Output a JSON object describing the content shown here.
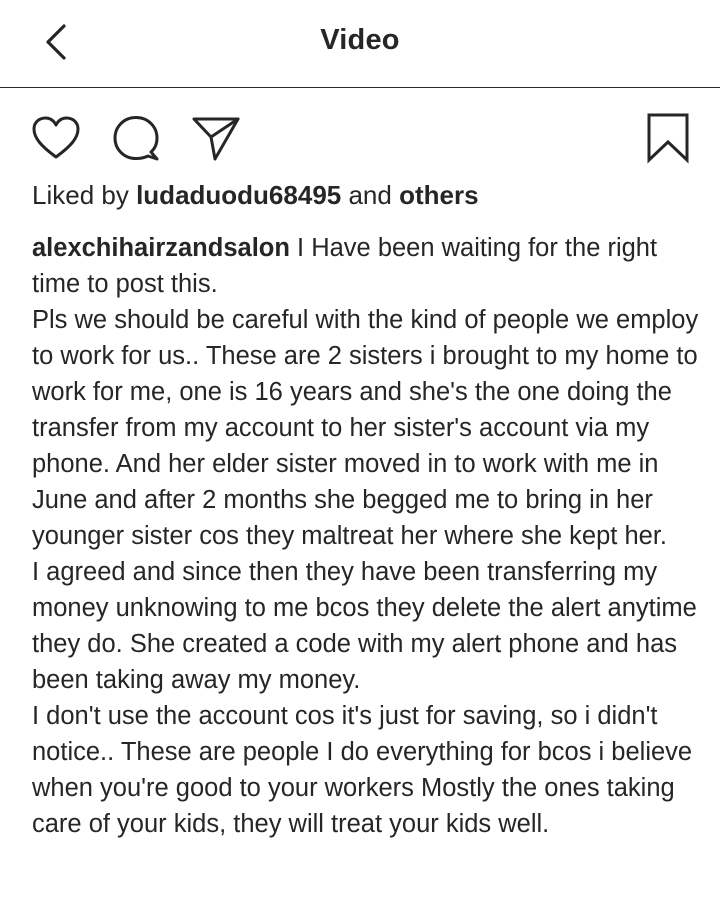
{
  "header": {
    "title": "Video",
    "back_icon": "chevron-left-icon"
  },
  "actions": {
    "icons": [
      "heart-icon",
      "comment-icon",
      "share-icon",
      "bookmark-icon"
    ]
  },
  "likes": {
    "prefix": "Liked by ",
    "user": "ludaduodu68495",
    "middle": " and ",
    "others": "others"
  },
  "caption": {
    "username": "alexchihairzandsalon",
    "paragraphs": [
      "I Have been waiting for the right time to post this.",
      "Pls we should be careful with the kind of people we employ to work for us.. These are 2 sisters i brought to my home to work for me, one is 16 years and she's the one doing the transfer from my account to her sister's account via my phone. And her elder sister moved in to work with me in June and after 2 months she begged me to bring in her younger sister cos they maltreat her where she kept her.",
      "I agreed and since then they have been transferring my money unknowing to me bcos they delete the alert anytime they do. She created a code with my alert phone and has been taking away my money.",
      "I don't use the account cos it's just for saving, so i didn't notice.. These are people I do everything for bcos i believe when you're good to your workers Mostly the ones taking care of your kids, they will treat your kids well."
    ]
  }
}
